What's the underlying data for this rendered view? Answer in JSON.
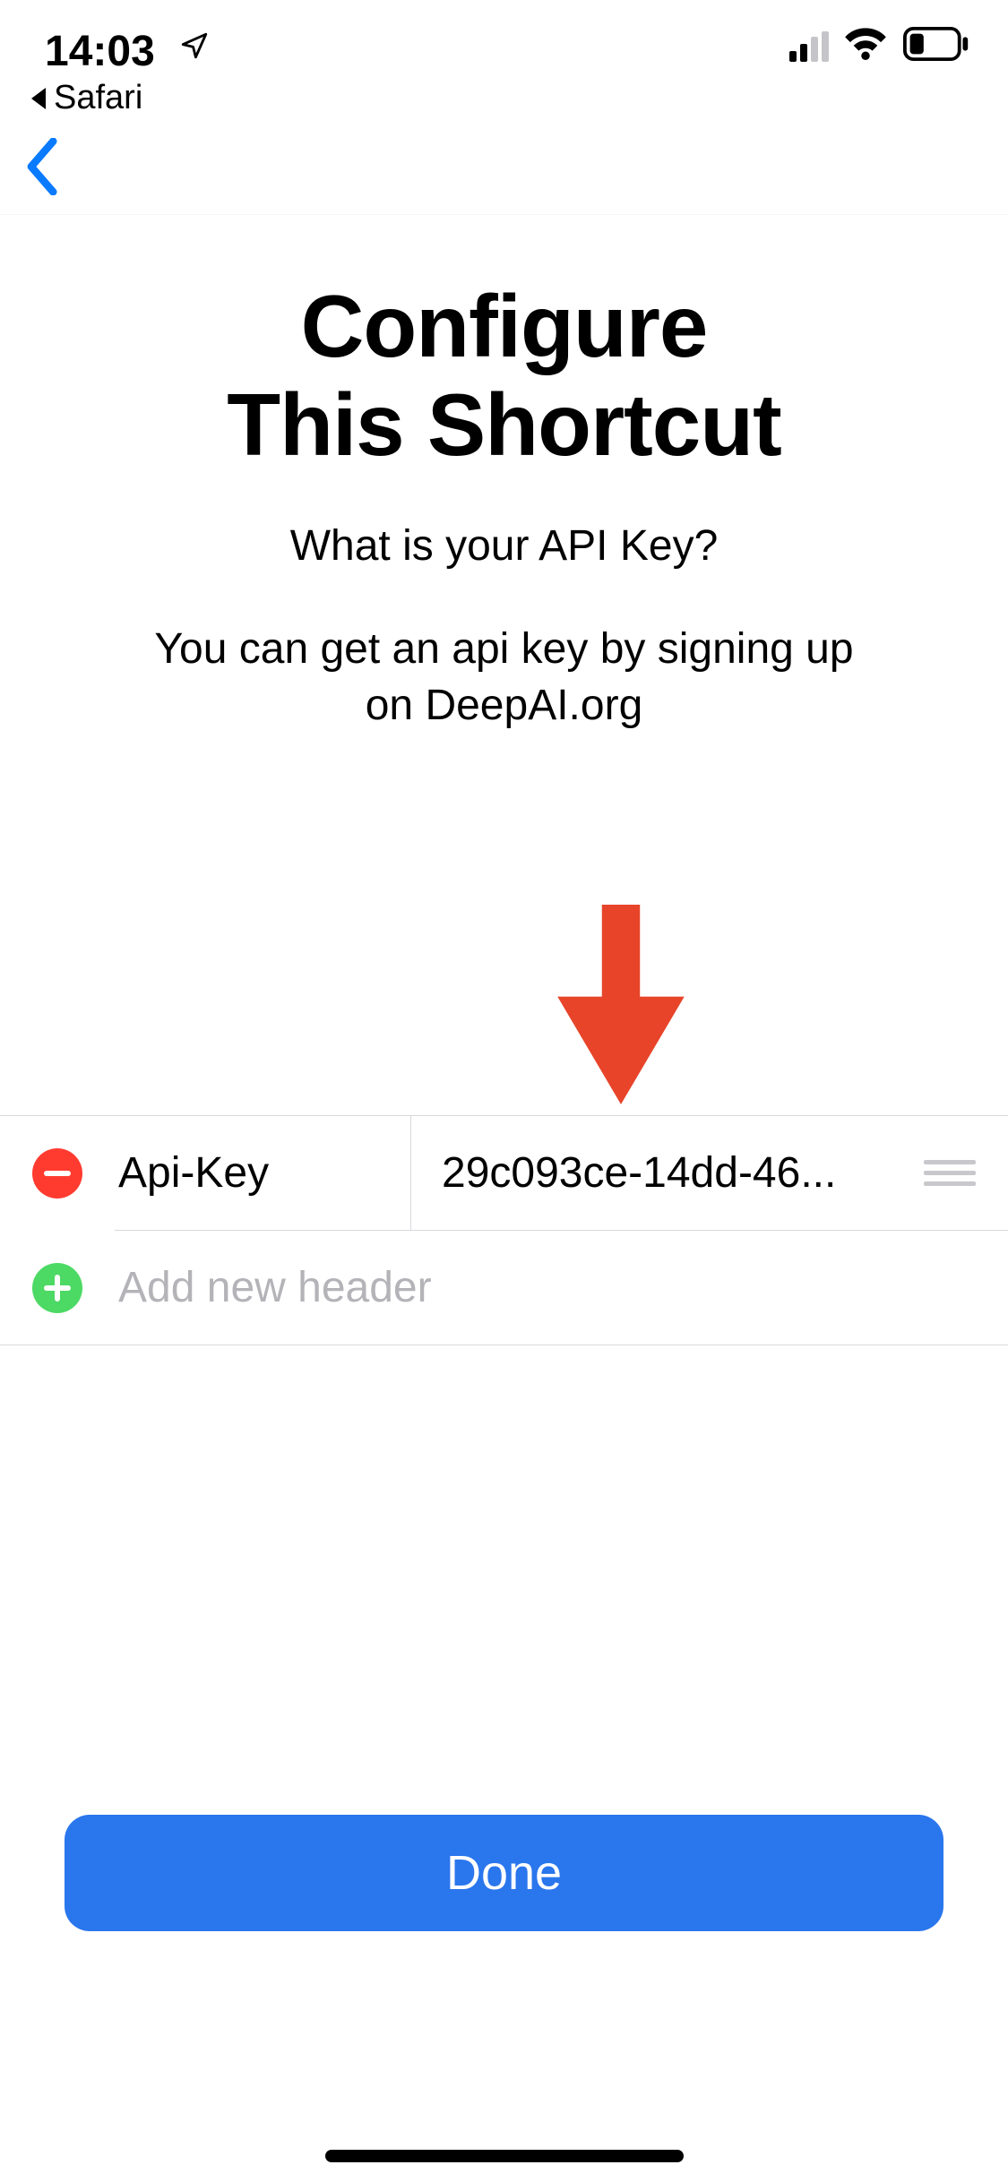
{
  "status": {
    "time": "14:03",
    "back_app_label": "Safari"
  },
  "header": {
    "title_line1": "Configure",
    "title_line2": "This Shortcut",
    "question": "What is your API Key?",
    "description_line1": "You can get an api key by signing up",
    "description_line2": "on DeepAI.org"
  },
  "headers_table": {
    "row": {
      "key": "Api-Key",
      "value": "29c093ce-14dd-46..."
    },
    "add_placeholder": "Add new header"
  },
  "footer": {
    "done_label": "Done"
  },
  "colors": {
    "accent_blue": "#2a76ed",
    "delete_red": "#ff3b30",
    "add_green": "#4cd964",
    "arrow_red": "#e7442a"
  }
}
